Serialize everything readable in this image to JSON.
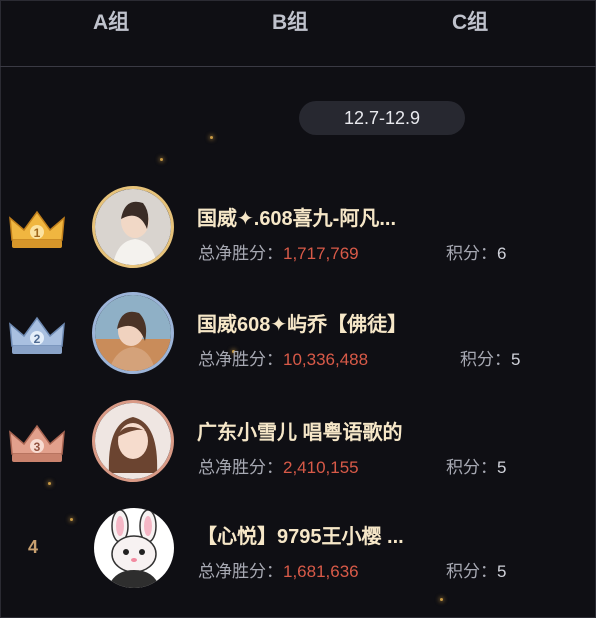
{
  "tabs": [
    "A组",
    "B组",
    "C组"
  ],
  "date_range": "12.7-12.9",
  "labels": {
    "net_win": "总净胜分：",
    "points": "积分："
  },
  "colors": {
    "gold": "#e6c27a",
    "silver": "#9cb4d8",
    "bronze": "#d99a86",
    "value_red": "#d85a48",
    "name": "#f6e7c8"
  },
  "rankings": [
    {
      "rank": "1",
      "medal": "gold-crown-icon",
      "name": "国威✦.608喜九-阿凡...",
      "net_score": "1,717,769",
      "points": "6"
    },
    {
      "rank": "2",
      "medal": "silver-crown-icon",
      "name": "国威608✦屿乔【佛徒】",
      "net_score": "10,336,488",
      "points": "5"
    },
    {
      "rank": "3",
      "medal": "bronze-crown-icon",
      "name": "广东小雪儿 唱粤语歌的",
      "net_score": "2,410,155",
      "points": "5"
    },
    {
      "rank": "4",
      "medal": "",
      "name": "【心悦】9795王小樱 ...",
      "net_score": "1,681,636",
      "points": "5"
    }
  ]
}
